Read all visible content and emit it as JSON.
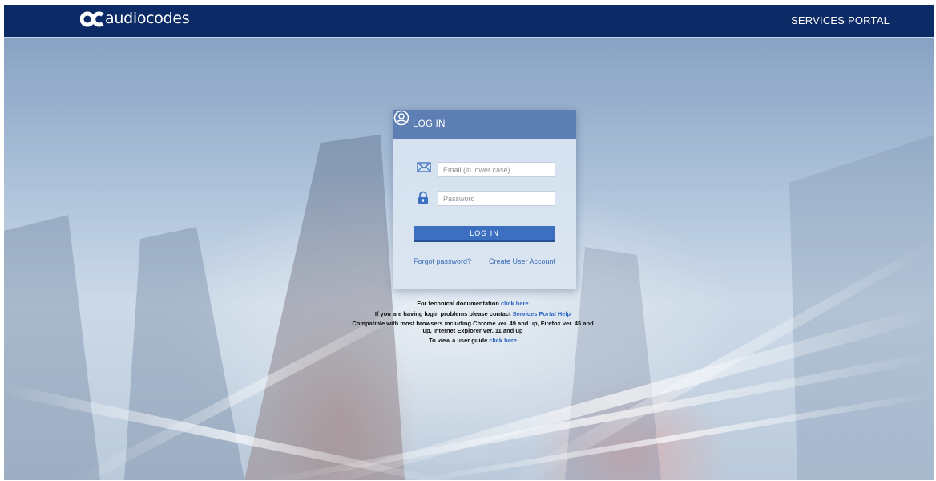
{
  "brand": {
    "logo_text": "audiocodes",
    "colors": {
      "navy": "#0b2a66",
      "card_header": "#5e7fb3",
      "button": "#3d6fc0",
      "link": "#2f66c4"
    }
  },
  "header": {
    "portal_title": "SERVICES PORTAL"
  },
  "login": {
    "title": "LOG IN",
    "email_placeholder": "Email (in lower case)",
    "email_value": "",
    "password_placeholder": "Password",
    "password_value": "",
    "submit_label": "LOG IN",
    "forgot_password": "Forgot password?",
    "create_account": "Create User Account"
  },
  "info": {
    "doc_text": "For technical documentation ",
    "doc_link": "click here",
    "help_text": "If you are having login problems please contact ",
    "help_link": "Services Portal Help",
    "compat_text": "Compatible with most browsers including Chrome ver. 49 and up, Firefox ver. 45 and up, Internet Explorer ver. 11 and up",
    "guide_text": "To view a user guide ",
    "guide_link": "click here"
  },
  "icons": [
    "logo-mark-icon",
    "user-circle-icon",
    "envelope-icon",
    "lock-icon"
  ]
}
